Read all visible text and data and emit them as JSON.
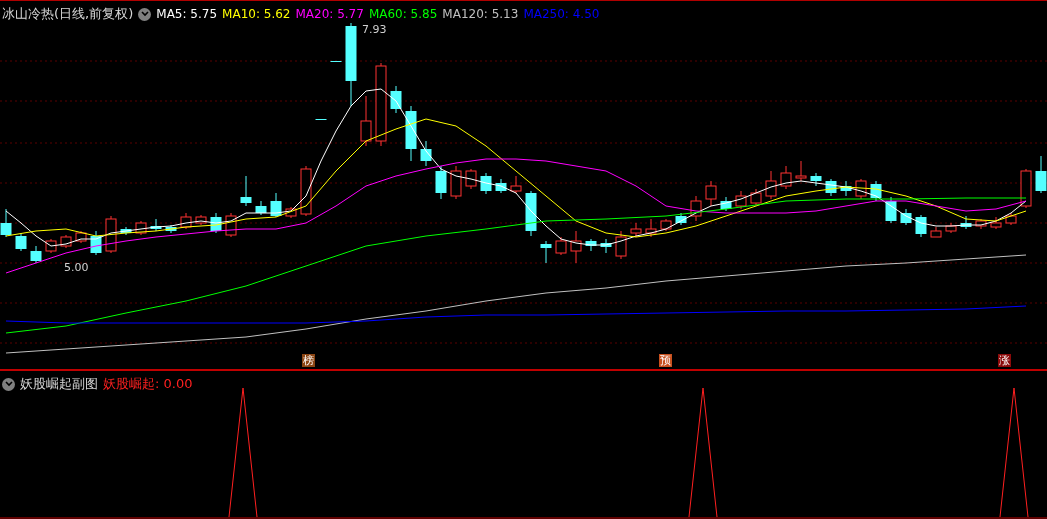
{
  "main_chart": {
    "title": "冰山冷热(日线,前复权)",
    "legend": [
      {
        "label": "MA5: 5.75",
        "color": "#ffffff"
      },
      {
        "label": "MA10: 5.62",
        "color": "#ffff00"
      },
      {
        "label": "MA20: 5.77",
        "color": "#ff00ff"
      },
      {
        "label": "MA60: 5.85",
        "color": "#00ff00"
      },
      {
        "label": "MA120: 5.13",
        "color": "#c0c0c0"
      },
      {
        "label": "MA250: 4.50",
        "color": "#0000ff"
      }
    ],
    "high_label": "7.93",
    "low_label": "5.00",
    "markers": [
      {
        "label": "榜",
        "color": "#8b4513"
      },
      {
        "label": "预",
        "color": "#c8501e"
      },
      {
        "label": "涨",
        "color": "#8b0a0a"
      }
    ]
  },
  "sub_chart": {
    "title": "妖股崛起副图",
    "indicator": "妖股崛起: 0.00"
  }
}
